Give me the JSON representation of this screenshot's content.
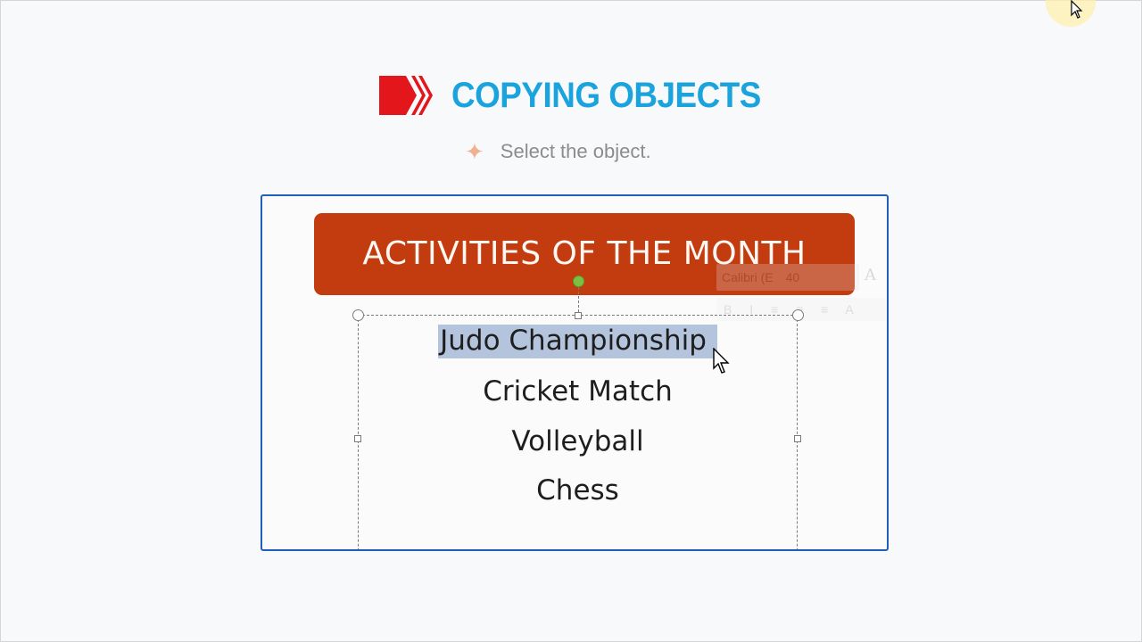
{
  "heading": {
    "title": "COPYING OBJECTS",
    "icon": "red-chevron-arrow-icon",
    "title_color": "#1aa3dc"
  },
  "bullet": {
    "icon": "four-point-star-icon",
    "text": "Select the object."
  },
  "slide": {
    "banner_text": "ACTIVITIES OF THE MONTH",
    "banner_color": "#c23c10",
    "border_color": "#1f5fba",
    "items": [
      "Judo Championship",
      "Cricket Match",
      "Volleyball",
      "Chess"
    ],
    "selected_item": "Judo Championship",
    "selection_color": "#b3c4dc"
  },
  "mini_toolbar": {
    "font_name": "Calibri (E",
    "font_size": "40",
    "format_buttons": "B I ≡ ≡ ≡ A"
  }
}
